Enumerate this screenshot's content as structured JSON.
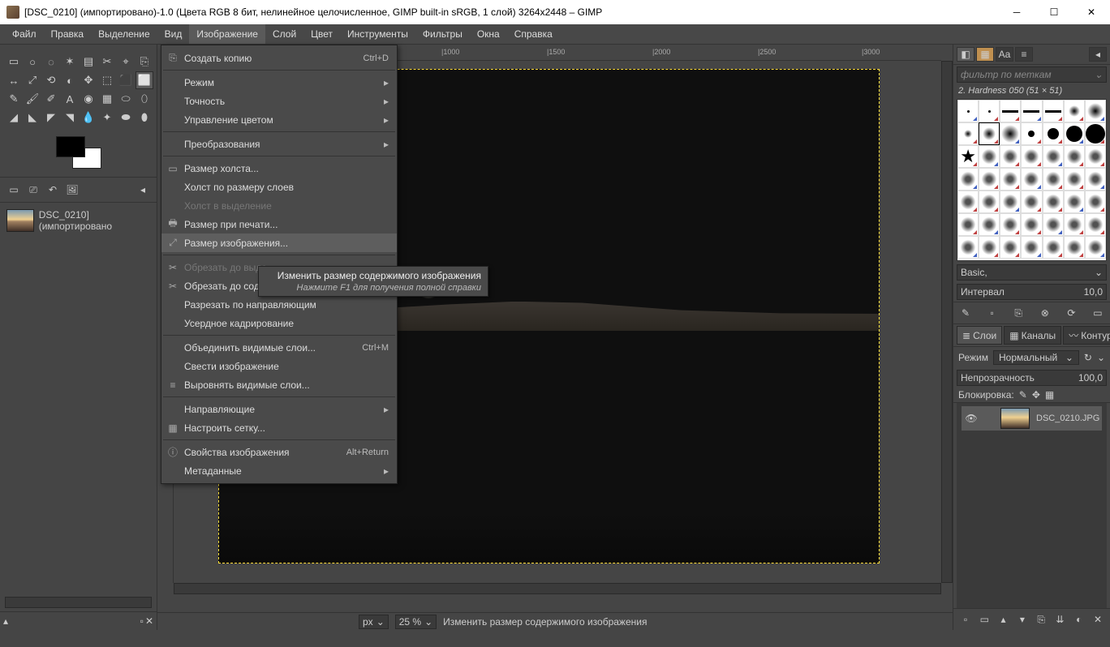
{
  "window": {
    "title": "[DSC_0210] (импортировано)-1.0 (Цвета RGB 8 бит, нелинейное целочисленное, GIMP built-in sRGB, 1 слой) 3264x2448 – GIMP"
  },
  "menubar": {
    "items": [
      "Файл",
      "Правка",
      "Выделение",
      "Вид",
      "Изображение",
      "Слой",
      "Цвет",
      "Инструменты",
      "Фильтры",
      "Окна",
      "Справка"
    ],
    "active_index": 4
  },
  "image_menu": {
    "items": [
      {
        "label": "Создать копию",
        "shortcut": "Ctrl+D",
        "icon": "copy"
      },
      {
        "sep": true
      },
      {
        "label": "Режим",
        "sub": true
      },
      {
        "label": "Точность",
        "sub": true
      },
      {
        "label": "Управление цветом",
        "sub": true
      },
      {
        "sep": true
      },
      {
        "label": "Преобразования",
        "sub": true
      },
      {
        "sep": true
      },
      {
        "label": "Размер холста...",
        "icon": "canvas"
      },
      {
        "label": "Холст по размеру слоев"
      },
      {
        "label": "Холст в выделение",
        "disabled": true
      },
      {
        "label": "Размер при печати...",
        "icon": "print"
      },
      {
        "label": "Размер изображения...",
        "icon": "scale",
        "hover": true
      },
      {
        "sep": true
      },
      {
        "label": "Обрезать до выде",
        "icon": "crop",
        "disabled": true
      },
      {
        "label": "Обрезать до содержимого",
        "icon": "crop"
      },
      {
        "label": "Разрезать по направляющим"
      },
      {
        "label": "Усердное кадрирование"
      },
      {
        "sep": true
      },
      {
        "label": "Объединить видимые слои...",
        "shortcut": "Ctrl+M"
      },
      {
        "label": "Свести изображение"
      },
      {
        "label": "Выровнять видимые слои...",
        "icon": "align"
      },
      {
        "sep": true
      },
      {
        "label": "Направляющие",
        "sub": true
      },
      {
        "label": "Настроить сетку...",
        "icon": "grid"
      },
      {
        "sep": true
      },
      {
        "label": "Свойства изображения",
        "shortcut": "Alt+Return",
        "icon": "info"
      },
      {
        "label": "Метаданные",
        "sub": true
      }
    ]
  },
  "tooltip": {
    "title": "Изменить размер содержимого изображения",
    "help": "Нажмите F1 для получения полной справки"
  },
  "imagelist": {
    "name": "DSC_0210] (импортировано"
  },
  "ruler_h": {
    "1000": 330,
    "1500": 460,
    "2000": 590,
    "2500": 720,
    "3000": 848
  },
  "status": {
    "unit": "px",
    "zoom": "25 %",
    "text": "Изменить размер содержимого изображения"
  },
  "brushes": {
    "filter_placeholder": "фильтр по меткам",
    "current": "2. Hardness 050 (51 × 51)",
    "preset": "Basic,",
    "spacing_label": "Интервал",
    "spacing_value": "10,0"
  },
  "layers": {
    "tabs": [
      "Слои",
      "Каналы",
      "Контуры"
    ],
    "mode_label": "Режим",
    "mode_value": "Нормальный",
    "opacity_label": "Непрозрачность",
    "opacity_value": "100,0",
    "lock_label": "Блокировка:",
    "layer_name": "DSC_0210.JPG"
  }
}
